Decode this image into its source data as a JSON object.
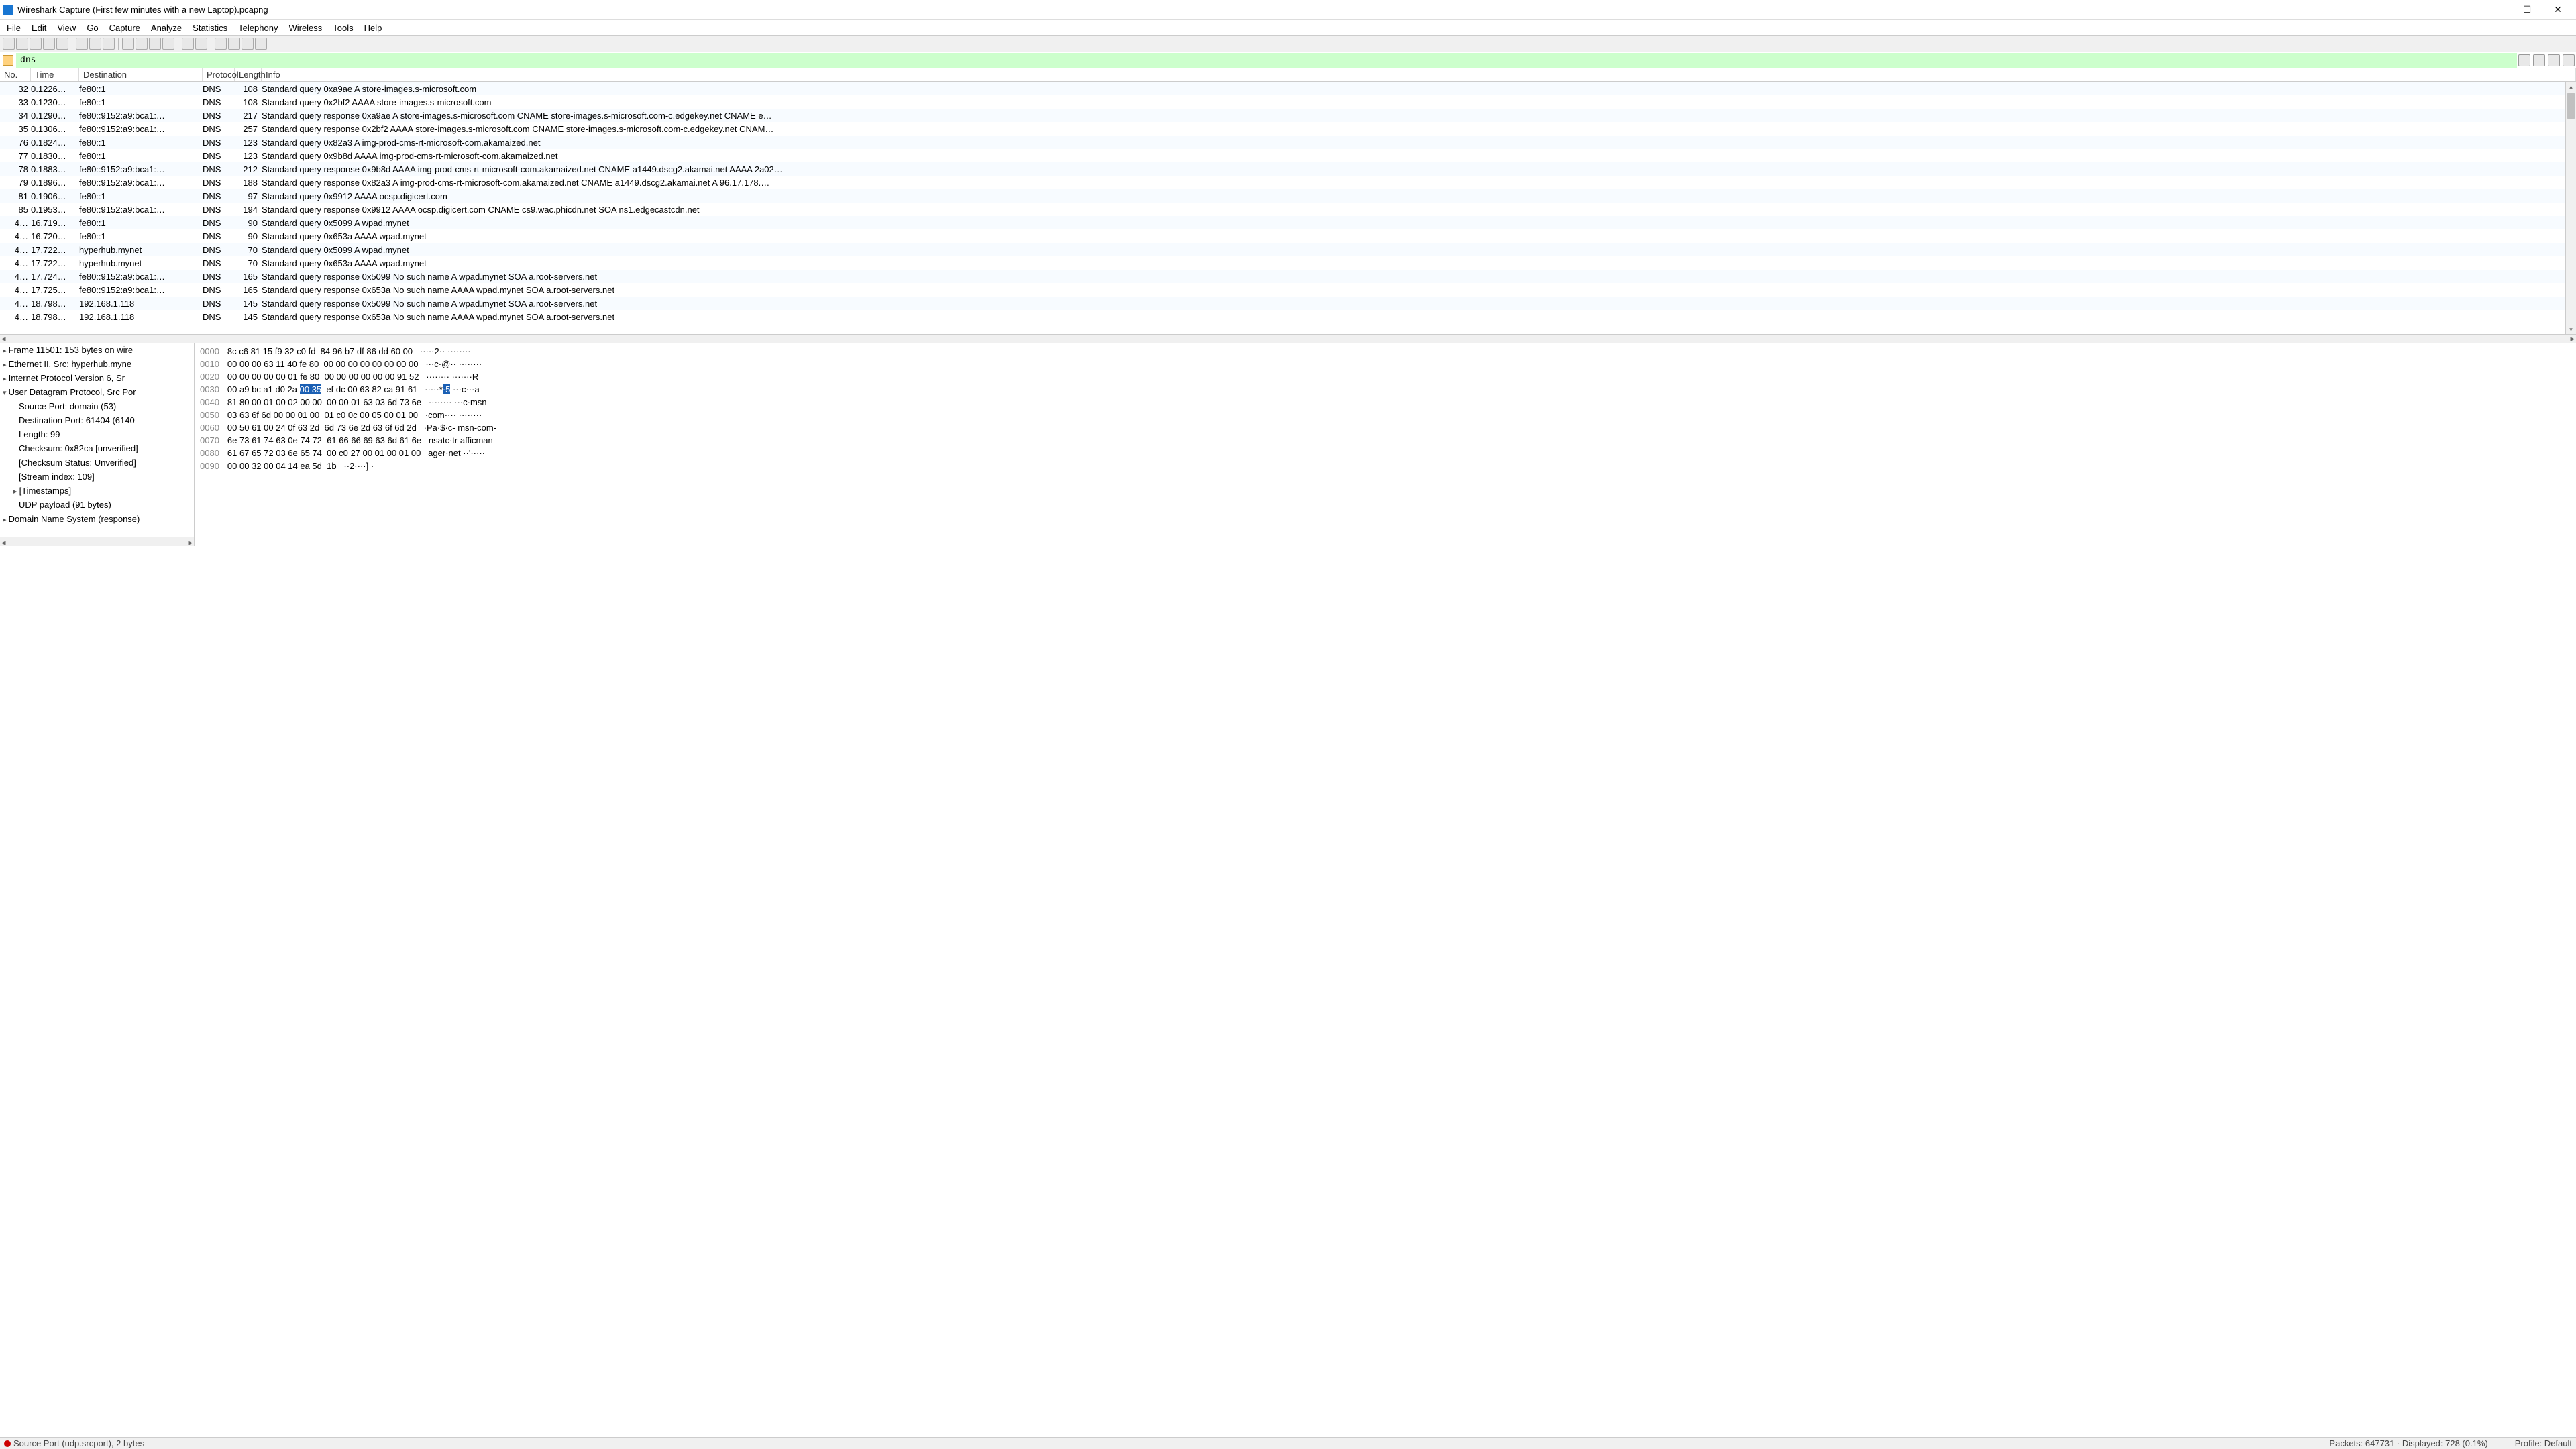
{
  "window": {
    "title": "Wireshark Capture (First few minutes with a new Laptop).pcapng"
  },
  "menu": [
    "File",
    "Edit",
    "View",
    "Go",
    "Capture",
    "Analyze",
    "Statistics",
    "Telephony",
    "Wireless",
    "Tools",
    "Help"
  ],
  "filter": {
    "value": "dns"
  },
  "columns": {
    "no": "No.",
    "time": "Time",
    "dest": "Destination",
    "proto": "Protocol",
    "len": "Length",
    "info": "Info"
  },
  "packets": [
    {
      "no": "32",
      "time": "0.1226…",
      "dest": "fe80::1",
      "proto": "DNS",
      "len": "108",
      "info": "Standard query 0xa9ae A store-images.s-microsoft.com"
    },
    {
      "no": "33",
      "time": "0.1230…",
      "dest": "fe80::1",
      "proto": "DNS",
      "len": "108",
      "info": "Standard query 0x2bf2 AAAA store-images.s-microsoft.com"
    },
    {
      "no": "34",
      "time": "0.1290…",
      "dest": "fe80::9152:a9:bca1:…",
      "proto": "DNS",
      "len": "217",
      "info": "Standard query response 0xa9ae A store-images.s-microsoft.com CNAME store-images.s-microsoft.com-c.edgekey.net CNAME e…"
    },
    {
      "no": "35",
      "time": "0.1306…",
      "dest": "fe80::9152:a9:bca1:…",
      "proto": "DNS",
      "len": "257",
      "info": "Standard query response 0x2bf2 AAAA store-images.s-microsoft.com CNAME store-images.s-microsoft.com-c.edgekey.net CNAM…"
    },
    {
      "no": "76",
      "time": "0.1824…",
      "dest": "fe80::1",
      "proto": "DNS",
      "len": "123",
      "info": "Standard query 0x82a3 A img-prod-cms-rt-microsoft-com.akamaized.net"
    },
    {
      "no": "77",
      "time": "0.1830…",
      "dest": "fe80::1",
      "proto": "DNS",
      "len": "123",
      "info": "Standard query 0x9b8d AAAA img-prod-cms-rt-microsoft-com.akamaized.net"
    },
    {
      "no": "78",
      "time": "0.1883…",
      "dest": "fe80::9152:a9:bca1:…",
      "proto": "DNS",
      "len": "212",
      "info": "Standard query response 0x9b8d AAAA img-prod-cms-rt-microsoft-com.akamaized.net CNAME a1449.dscg2.akamai.net AAAA 2a02…"
    },
    {
      "no": "79",
      "time": "0.1896…",
      "dest": "fe80::9152:a9:bca1:…",
      "proto": "DNS",
      "len": "188",
      "info": "Standard query response 0x82a3 A img-prod-cms-rt-microsoft-com.akamaized.net CNAME a1449.dscg2.akamai.net A 96.17.178.…"
    },
    {
      "no": "81",
      "time": "0.1906…",
      "dest": "fe80::1",
      "proto": "DNS",
      "len": "97",
      "info": "Standard query 0x9912 AAAA ocsp.digicert.com"
    },
    {
      "no": "85",
      "time": "0.1953…",
      "dest": "fe80::9152:a9:bca1:…",
      "proto": "DNS",
      "len": "194",
      "info": "Standard query response 0x9912 AAAA ocsp.digicert.com CNAME cs9.wac.phicdn.net SOA ns1.edgecastcdn.net"
    },
    {
      "no": "4…",
      "time": "16.719…",
      "dest": "fe80::1",
      "proto": "DNS",
      "len": "90",
      "info": "Standard query 0x5099 A wpad.mynet"
    },
    {
      "no": "4…",
      "time": "16.720…",
      "dest": "fe80::1",
      "proto": "DNS",
      "len": "90",
      "info": "Standard query 0x653a AAAA wpad.mynet"
    },
    {
      "no": "4…",
      "time": "17.722…",
      "dest": "hyperhub.mynet",
      "proto": "DNS",
      "len": "70",
      "info": "Standard query 0x5099 A wpad.mynet"
    },
    {
      "no": "4…",
      "time": "17.722…",
      "dest": "hyperhub.mynet",
      "proto": "DNS",
      "len": "70",
      "info": "Standard query 0x653a AAAA wpad.mynet"
    },
    {
      "no": "4…",
      "time": "17.724…",
      "dest": "fe80::9152:a9:bca1:…",
      "proto": "DNS",
      "len": "165",
      "info": "Standard query response 0x5099 No such name A wpad.mynet SOA a.root-servers.net"
    },
    {
      "no": "4…",
      "time": "17.725…",
      "dest": "fe80::9152:a9:bca1:…",
      "proto": "DNS",
      "len": "165",
      "info": "Standard query response 0x653a No such name AAAA wpad.mynet SOA a.root-servers.net"
    },
    {
      "no": "4…",
      "time": "18.798…",
      "dest": "192.168.1.118",
      "proto": "DNS",
      "len": "145",
      "info": "Standard query response 0x5099 No such name A wpad.mynet SOA a.root-servers.net"
    },
    {
      "no": "4…",
      "time": "18.798…",
      "dest": "192.168.1.118",
      "proto": "DNS",
      "len": "145",
      "info": "Standard query response 0x653a No such name AAAA wpad.mynet SOA a.root-servers.net"
    }
  ],
  "tree": [
    {
      "cls": "expand",
      "txt": "Frame 11501: 153 bytes on wire"
    },
    {
      "cls": "expand",
      "txt": "Ethernet II, Src: hyperhub.myne"
    },
    {
      "cls": "expand",
      "txt": "Internet Protocol Version 6, Sr"
    },
    {
      "cls": "open",
      "txt": "User Datagram Protocol, Src Por"
    },
    {
      "cls": "ind",
      "txt": "Source Port: domain (53)"
    },
    {
      "cls": "ind",
      "txt": "Destination Port: 61404 (6140"
    },
    {
      "cls": "ind",
      "txt": "Length: 99"
    },
    {
      "cls": "ind",
      "txt": "Checksum: 0x82ca [unverified]"
    },
    {
      "cls": "ind",
      "txt": "[Checksum Status: Unverified]"
    },
    {
      "cls": "ind",
      "txt": "[Stream index: 109]"
    },
    {
      "cls": "ind2 expand",
      "txt": "[Timestamps]"
    },
    {
      "cls": "ind",
      "txt": "UDP payload (91 bytes)"
    },
    {
      "cls": "expand",
      "txt": "Domain Name System (response)"
    }
  ],
  "hex": [
    {
      "off": "0000",
      "b": "8c c6 81 15 f9 32 c0 fd  84 96 b7 df 86 dd 60 00",
      "a": "·····2·· ········"
    },
    {
      "off": "0010",
      "b": "00 00 00 63 11 40 fe 80  00 00 00 00 00 00 00 00",
      "a": "···c·@·· ········"
    },
    {
      "off": "0020",
      "b": "00 00 00 00 00 01 fe 80  00 00 00 00 00 00 91 52",
      "a": "········ ·······R"
    },
    {
      "off": "0030",
      "b": "00 a9 bc a1 d0 2a ",
      "sel": "00 35",
      "b2": "  ef dc 00 63 82 ca 91 61",
      "a": "·····*",
      "asel": "·5",
      "a2": " ···c···a"
    },
    {
      "off": "0040",
      "b": "81 80 00 01 00 02 00 00  00 00 01 63 03 6d 73 6e",
      "a": "········ ···c·msn"
    },
    {
      "off": "0050",
      "b": "03 63 6f 6d 00 00 01 00  01 c0 0c 00 05 00 01 00",
      "a": "·com···· ········"
    },
    {
      "off": "0060",
      "b": "00 50 61 00 24 0f 63 2d  6d 73 6e 2d 63 6f 6d 2d",
      "a": "·Pa·$·c- msn-com-"
    },
    {
      "off": "0070",
      "b": "6e 73 61 74 63 0e 74 72  61 66 66 69 63 6d 61 6e",
      "a": "nsatc·tr afficman"
    },
    {
      "off": "0080",
      "b": "61 67 65 72 03 6e 65 74  00 c0 27 00 01 00 01 00",
      "a": "ager·net ··'·····"
    },
    {
      "off": "0090",
      "b": "00 00 32 00 04 14 ea 5d  1b",
      "a": "··2····] ·"
    }
  ],
  "status": {
    "left": "Source Port (udp.srcport), 2 bytes",
    "packets": "Packets: 647731 · Displayed: 728 (0.1%)",
    "profile": "Profile: Default"
  }
}
